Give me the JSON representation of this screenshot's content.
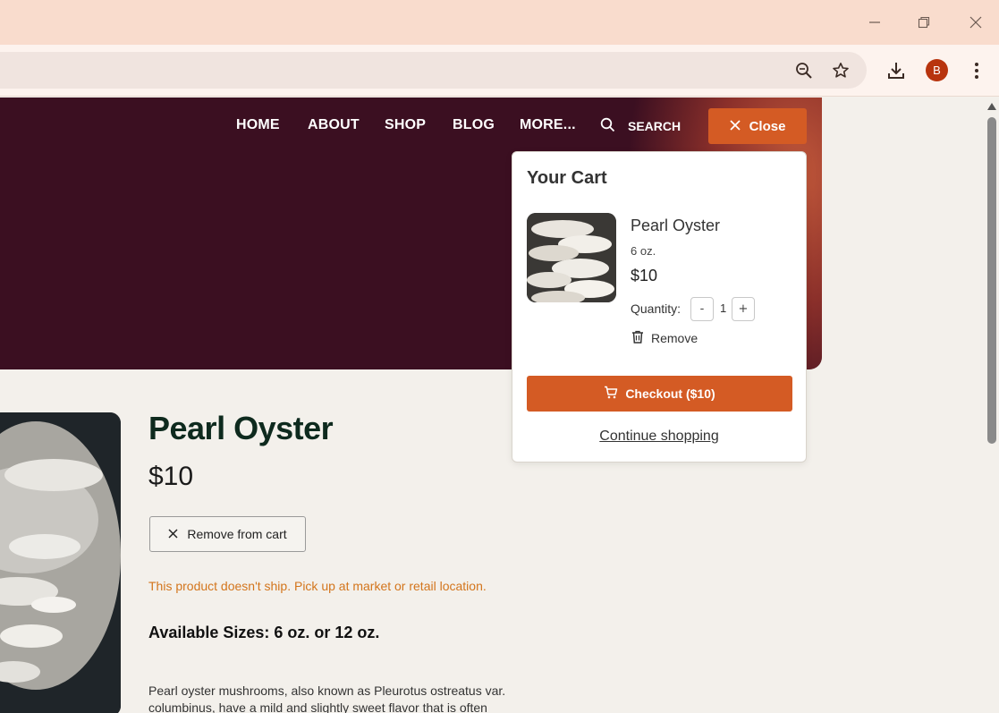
{
  "browser": {
    "avatar_initial": "B",
    "icons": [
      "minimize-icon",
      "restore-icon",
      "close-window-icon",
      "zoom-icon",
      "bookmark-star-icon",
      "download-icon",
      "menu-kebab-icon"
    ]
  },
  "nav": {
    "items": [
      {
        "label": "HOME"
      },
      {
        "label": "ABOUT"
      },
      {
        "label": "SHOP"
      },
      {
        "label": "BLOG"
      },
      {
        "label": "MORE..."
      }
    ],
    "search_label": "SEARCH",
    "close_label": "Close"
  },
  "product": {
    "title": "Pearl Oyster",
    "price": "$10",
    "remove_from_cart_label": "Remove from cart",
    "ship_note": "This product doesn't ship. Pick up at market or retail location.",
    "sizes_text": "Available Sizes: 6 oz. or 12 oz.",
    "description": "Pearl oyster mushrooms, also known as Pleurotus ostreatus var. columbinus, have a mild and slightly sweet flavor that is often"
  },
  "cart": {
    "title": "Your Cart",
    "item": {
      "name": "Pearl Oyster",
      "size": "6 oz.",
      "price": "$10",
      "quantity_label": "Quantity:",
      "quantity": "1",
      "minus": "-",
      "plus": "+",
      "remove_label": "Remove"
    },
    "checkout_label": "Checkout ($10)",
    "continue_label": "Continue shopping"
  },
  "colors": {
    "accent": "#d45b24",
    "hero_bg": "#3b0f21",
    "page_bg": "#f3f0eb",
    "ship_note": "#d3751c",
    "title": "#0e2a1e"
  }
}
